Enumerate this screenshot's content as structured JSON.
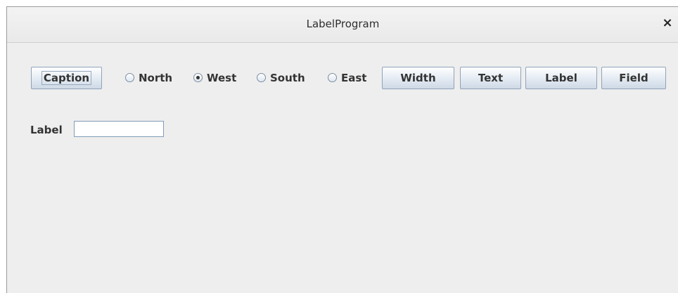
{
  "window": {
    "title": "LabelProgram",
    "close_symbol": "×"
  },
  "toolbar": {
    "caption_label": "Caption",
    "radios": [
      {
        "label": "North",
        "selected": false
      },
      {
        "label": "West",
        "selected": true
      },
      {
        "label": "South",
        "selected": false
      },
      {
        "label": "East",
        "selected": false
      }
    ],
    "width_label": "Width",
    "text_label": "Text",
    "label_label": "Label",
    "field_label": "Field"
  },
  "form": {
    "label_text": "Label",
    "field_value": ""
  }
}
